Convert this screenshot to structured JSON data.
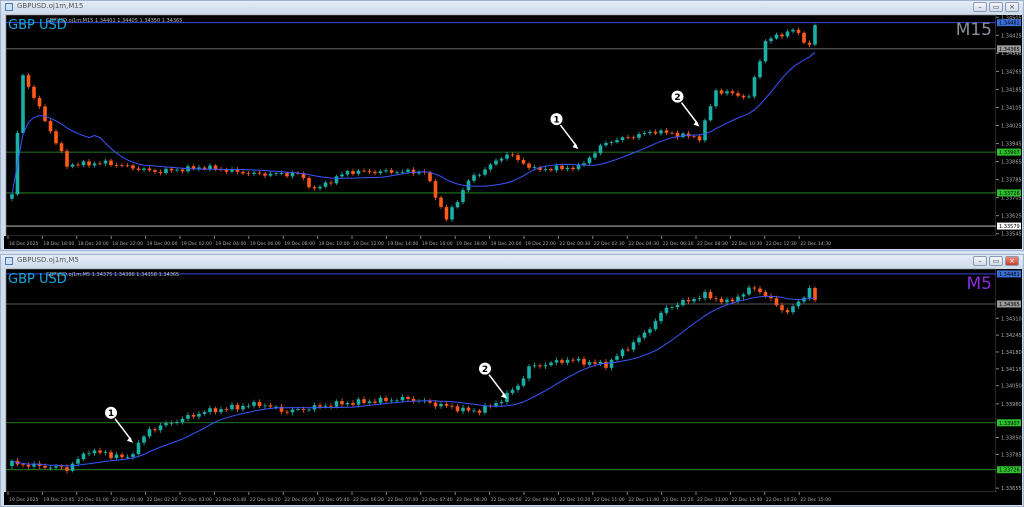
{
  "colors": {
    "bull": "#1ab0a8",
    "bear": "#ff5a1a",
    "ma": "#3a55ff",
    "bg": "#000000",
    "grid": "#555555"
  },
  "charts": [
    {
      "window_title": "GBPUSD.oj1m,M15",
      "ohlc_header": "GBPUSD.oj1m,M15 1.34401 1.34405 1.34350 1.34365",
      "symbol": "GBP USD",
      "timeframe": "M15",
      "tf_color": "#8a8f99",
      "price_min": 1.33535,
      "price_max": 1.34515,
      "price_ticks": [
        "1.34505",
        "1.34425",
        "1.34346",
        "1.34265",
        "1.34185",
        "1.34105",
        "1.34025",
        "1.33945",
        "1.33865",
        "1.33785",
        "1.33705",
        "1.33625",
        "1.33545"
      ],
      "levels": [
        {
          "price": "1.34481",
          "color": "#3a55ff",
          "tag": "#3a6fd8"
        },
        {
          "price": "1.34365",
          "color": "#777777",
          "tag": "#9a9a9a"
        },
        {
          "price": "1.33907",
          "color": "#2a9a2a",
          "tag": "#2ec12e"
        },
        {
          "price": "1.33726",
          "color": "#2a9a2a",
          "tag": "#2ec12e"
        },
        {
          "price": "1.33579",
          "color": "#dddddd",
          "tag": "#ffffff"
        }
      ],
      "time_labels": [
        "18 Dec 2025",
        "18 Dec 18:00",
        "18 Dec 20:00",
        "18 Dec 22:00",
        "19 Dec 00:00",
        "19 Dec 02:00",
        "19 Dec 04:00",
        "19 Dec 06:00",
        "19 Dec 08:00",
        "19 Dec 10:00",
        "19 Dec 12:00",
        "19 Dec 14:00",
        "19 Dec 16:00",
        "19 Dec 18:00",
        "19 Dec 20:00",
        "19 Dec 22:00",
        "22 Dec 00:30",
        "22 Dec 02:30",
        "22 Dec 04:30",
        "22 Dec 06:30",
        "22 Dec 08:30",
        "22 Dec 10:30",
        "22 Dec 12:30",
        "22 Dec 14:30"
      ],
      "price_path": [
        [
          0,
          1.3372
        ],
        [
          2,
          1.3425
        ],
        [
          4,
          1.3415
        ],
        [
          8,
          1.3395
        ],
        [
          10,
          1.3385
        ],
        [
          17,
          1.3386
        ],
        [
          26,
          1.3382
        ],
        [
          35,
          1.3384
        ],
        [
          44,
          1.3381
        ],
        [
          52,
          1.3381
        ],
        [
          55,
          1.3374
        ],
        [
          61,
          1.3382
        ],
        [
          75,
          1.3382
        ],
        [
          79,
          1.3361
        ],
        [
          83,
          1.3378
        ],
        [
          90,
          1.339
        ],
        [
          95,
          1.3383
        ],
        [
          103,
          1.3384
        ],
        [
          108,
          1.3395
        ],
        [
          117,
          1.34
        ],
        [
          125,
          1.3397
        ],
        [
          128,
          1.3418
        ],
        [
          134,
          1.3415
        ],
        [
          137,
          1.344
        ],
        [
          142,
          1.3445
        ],
        [
          145,
          1.3438
        ],
        [
          146,
          1.3447
        ]
      ],
      "markers": [
        {
          "label": "1",
          "index": 103,
          "price": "1.3392"
        },
        {
          "label": "2",
          "index": 125,
          "price": "1.3402"
        }
      ]
    },
    {
      "window_title": "GBPUSD.oj1m,M5",
      "ohlc_header": "GBPUSD.oj1m,M5 1.34375 1.34386 1.34358 1.34365",
      "symbol": "GBP USD",
      "timeframe": "M5",
      "tf_color": "#8a2be2",
      "price_min": 1.3364,
      "price_max": 1.345,
      "price_ticks": [
        "1.34310",
        "1.34245",
        "1.34180",
        "1.34115",
        "1.34050",
        "1.33980",
        "1.33850",
        "1.33785",
        "1.33655"
      ],
      "levels": [
        {
          "price": "1.34481",
          "color": "#3a55ff",
          "tag": "#3a6fd8"
        },
        {
          "price": "1.34365",
          "color": "#777777",
          "tag": "#9a9a9a"
        },
        {
          "price": "1.33907",
          "color": "#2a9a2a",
          "tag": "#2ec12e"
        },
        {
          "price": "1.33726",
          "color": "#2a9a2a",
          "tag": "#2ec12e"
        }
      ],
      "time_labels": [
        "19 Dec 2025",
        "19 Dec 23:45",
        "22 Dec 01:00",
        "22 Dec 01:40",
        "22 Dec 02:20",
        "22 Dec 03:00",
        "22 Dec 03:40",
        "22 Dec 04:20",
        "22 Dec 05:00",
        "22 Dec 05:40",
        "22 Dec 06:20",
        "22 Dec 07:00",
        "22 Dec 07:40",
        "22 Dec 08:20",
        "22 Dec 09:00",
        "22 Dec 09:40",
        "22 Dec 10:20",
        "22 Dec 11:00",
        "22 Dec 11:40",
        "22 Dec 12:20",
        "22 Dec 13:00",
        "22 Dec 13:40",
        "22 Dec 14:20",
        "22 Dec 15:00"
      ],
      "price_path": [
        [
          0,
          1.3375
        ],
        [
          10,
          1.3373
        ],
        [
          14,
          1.338
        ],
        [
          21,
          1.3377
        ],
        [
          25,
          1.3388
        ],
        [
          35,
          1.3395
        ],
        [
          45,
          1.3398
        ],
        [
          50,
          1.3395
        ],
        [
          59,
          1.3398
        ],
        [
          72,
          1.34
        ],
        [
          84,
          1.3395
        ],
        [
          88,
          1.3398
        ],
        [
          92,
          1.3405
        ],
        [
          94,
          1.3412
        ],
        [
          101,
          1.3415
        ],
        [
          108,
          1.3413
        ],
        [
          115,
          1.3425
        ],
        [
          119,
          1.3435
        ],
        [
          126,
          1.344
        ],
        [
          130,
          1.3437
        ],
        [
          135,
          1.3443
        ],
        [
          141,
          1.3433
        ],
        [
          145,
          1.3442
        ],
        [
          146,
          1.3438
        ]
      ],
      "markers": [
        {
          "label": "1",
          "index": 22,
          "price": "1.3383"
        },
        {
          "label": "2",
          "index": 90,
          "price": "1.3400"
        }
      ]
    }
  ]
}
